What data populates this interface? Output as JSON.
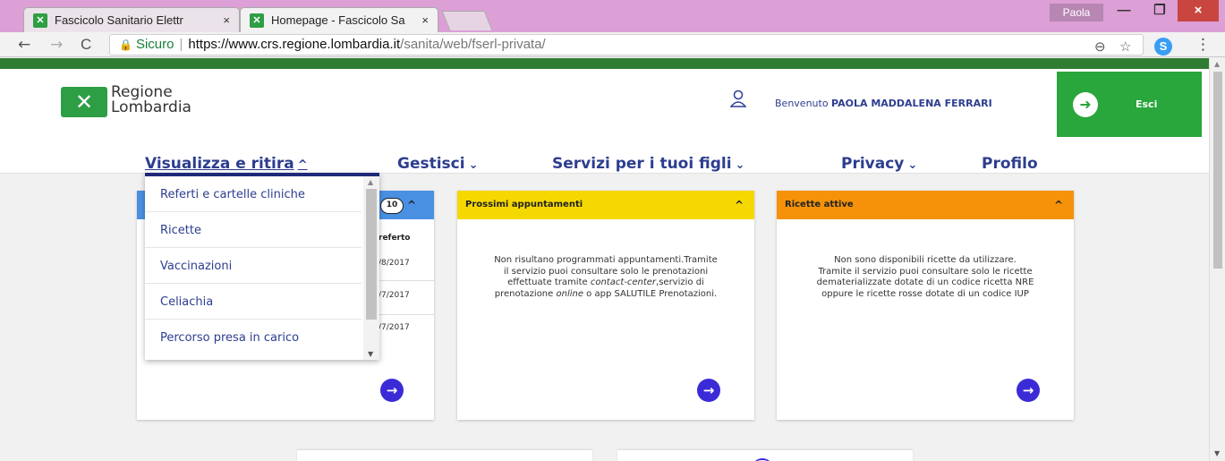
{
  "browser": {
    "tabs": [
      {
        "label": "Fascicolo Sanitario Elettr",
        "close": "×"
      },
      {
        "label": "Homepage - Fascicolo Sa",
        "close": "×"
      }
    ],
    "profile_name": "Paola",
    "window_controls": {
      "minimize": "—",
      "maximize": "❐",
      "close": "×"
    },
    "nav": {
      "back": "←",
      "forward": "→",
      "reload": "C"
    },
    "address": {
      "secure_label": "Sicuro",
      "url_host": "https://www.crs.regione.lombardia.it",
      "url_path": "/sanita/web/fserl-privata/"
    },
    "omnibox_icons": {
      "zoom": "⊖",
      "bookmark": "☆"
    },
    "extension_label": "S",
    "menu_icon": "⋮"
  },
  "header": {
    "logo_line1": "Regione",
    "logo_line2": "Lombardia",
    "welcome_prefix": "Benvenuto ",
    "user_name": "PAOLA MADDALENA FERRARI",
    "exit_label": "Esci"
  },
  "nav": {
    "items": [
      {
        "label": "Visualizza e ritira",
        "chevron": "^"
      },
      {
        "label": "Gestisci",
        "chevron": "⌄"
      },
      {
        "label": "Servizi per i tuoi figli",
        "chevron": "⌄"
      },
      {
        "label": "Privacy",
        "chevron": "⌄"
      },
      {
        "label": "Profilo"
      }
    ]
  },
  "dropdown": {
    "items": [
      "Referti e cartelle cliniche",
      "Ricette",
      "Vaccinazioni",
      "Celiachia",
      "Percorso presa in carico"
    ]
  },
  "cards": {
    "referti": {
      "count": "10",
      "column_header": "referto",
      "dates": [
        "/8/2017",
        "/7/2017",
        "/7/2017"
      ]
    },
    "appuntamenti": {
      "title": "Prossimi appuntamenti",
      "text_1": "Non risultano programmati appuntamenti.Tramite il servizio puoi consultare solo le prenotazioni effettuate tramite ",
      "text_italic_1": "contact-center",
      "text_2": ",servizio di prenotazione ",
      "text_italic_2": "online",
      "text_3": " o app SALUTILE Prenotazioni."
    },
    "ricette": {
      "title": "Ricette attive",
      "text_1": "Non sono disponibili ricette da utilizzare.",
      "text_2": "Tramite il servizio puoi consultare solo le ricette dematerializzate dotate di un codice ricetta NRE oppure le ricette rosse dotate di un codice IUP"
    }
  },
  "colors": {
    "brand_green": "#2e7d32",
    "exit_green": "#29a63c",
    "nav_blue": "#2d3e8f",
    "card_referti": "#4a90e2",
    "card_appuntamenti": "#f5d800",
    "card_ricette": "#f5920a",
    "arrow_button": "#3b2bd6"
  },
  "icons": {
    "user": "user-icon",
    "exit": "exit-icon",
    "arrow": "→",
    "collapse": "^"
  }
}
